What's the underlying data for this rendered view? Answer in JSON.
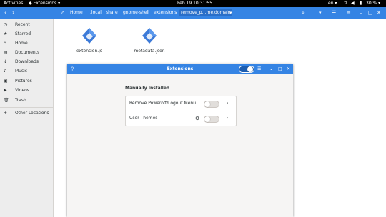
{
  "topbar": {
    "activities": "Activities",
    "app_menu": "Extensions",
    "app_menu_arrow": "▾",
    "clock": "Feb 19  10:31:55",
    "language": "en",
    "language_arrow": "▾",
    "battery": "30 %",
    "battery_arrow": "▾"
  },
  "headerbar": {
    "breadcrumbs": [
      "Home",
      ".local",
      "share",
      "gnome-shell",
      "extensions",
      "remove_p…me.domain"
    ],
    "dropdown": "▾"
  },
  "sidebar": {
    "items": [
      {
        "icon": "clock-icon",
        "label": "Recent"
      },
      {
        "icon": "star-icon",
        "label": "Starred"
      },
      {
        "icon": "home-icon",
        "label": "Home"
      },
      {
        "icon": "documents-icon",
        "label": "Documents"
      },
      {
        "icon": "download-icon",
        "label": "Downloads"
      },
      {
        "icon": "music-icon",
        "label": "Music"
      },
      {
        "icon": "pictures-icon",
        "label": "Pictures"
      },
      {
        "icon": "videos-icon",
        "label": "Videos"
      },
      {
        "icon": "trash-icon",
        "label": "Trash"
      }
    ],
    "other_locations": "Other Locations"
  },
  "files": [
    {
      "name": "extension.js",
      "icon": "javascript-file-icon"
    },
    {
      "name": "metadata.json",
      "icon": "json-file-icon"
    }
  ],
  "extensions_window": {
    "title": "Extensions",
    "global_toggle_on": true,
    "section_title": "Manually Installed",
    "extensions": [
      {
        "name": "Remove Poweroff/Logout Menu",
        "enabled": false,
        "has_settings": false
      },
      {
        "name": "User Themes",
        "enabled": false,
        "has_settings": true
      }
    ]
  },
  "colors": {
    "accent": "#3584e4",
    "topbar": "#000000",
    "sidebar": "#ededed",
    "file_icon_blue": "#3c7ad8"
  }
}
